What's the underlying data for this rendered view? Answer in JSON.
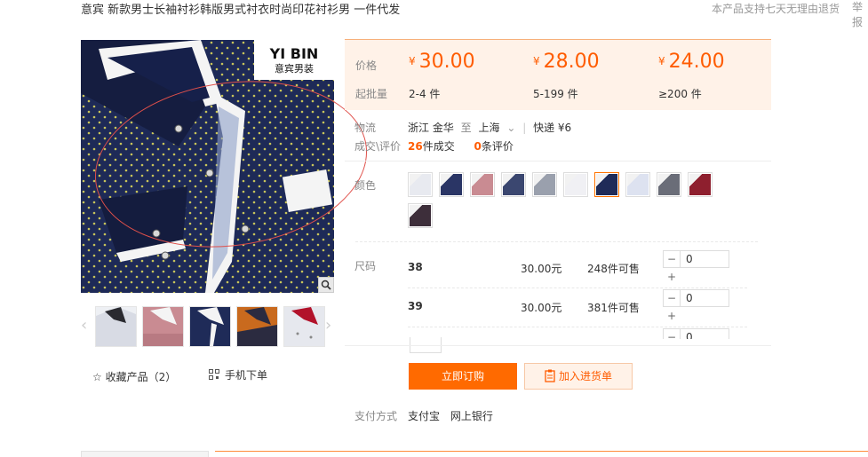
{
  "header": {
    "title": "意宾 新款男士长袖衬衫韩版男式衬衣时尚印花衬衫男 一件代发",
    "notice": "本产品支持七天无理由退货",
    "report": "举报"
  },
  "gallery": {
    "brand_en": "YI BIN",
    "brand_cn": "意宾男装",
    "prev": "‹",
    "next": "›",
    "thumbs": [
      "white-shirt",
      "pink-print-shirt",
      "navy-shirt",
      "orange-print-shirt",
      "white-print-shirt"
    ],
    "favorite": "☆ 收藏产品（2）",
    "mobile_order": "手机下单"
  },
  "pricing": {
    "price_label": "价格",
    "moq_label": "起批量",
    "currency": "¥",
    "tiers": [
      {
        "price": "30.00",
        "moq": "2-4 件"
      },
      {
        "price": "28.00",
        "moq": "5-199 件"
      },
      {
        "price": "24.00",
        "moq": "≥200 件"
      }
    ]
  },
  "logistics": {
    "label": "物流",
    "from": "浙江 金华",
    "to_word": "至",
    "to": "上海",
    "dropdown": "⌄",
    "divider": "|",
    "express": "快递 ¥6"
  },
  "stats": {
    "label": "成交\\评价",
    "sold_count": "26",
    "sold_text": "件成交",
    "review_count": "0",
    "review_text": "条评价"
  },
  "colors": {
    "label": "颜色",
    "accent": "#ff5c00",
    "swatches": [
      {
        "name": "white",
        "color": "#e8eaf0",
        "selected": false
      },
      {
        "name": "navy-white",
        "color": "#2a3565",
        "selected": false
      },
      {
        "name": "pink",
        "color": "#c98b92",
        "selected": false
      },
      {
        "name": "dark-blue",
        "color": "#3b4770",
        "selected": false
      },
      {
        "name": "grey",
        "color": "#9aa0ad",
        "selected": false
      },
      {
        "name": "light-white",
        "color": "#f0f0f4",
        "selected": false
      },
      {
        "name": "navy",
        "color": "#1f2b58",
        "selected": true
      },
      {
        "name": "white-blue",
        "color": "#dde2f0",
        "selected": false
      },
      {
        "name": "black-white",
        "color": "#6a6d78",
        "selected": false
      },
      {
        "name": "wine-red",
        "color": "#8e1f2e",
        "selected": false
      },
      {
        "name": "brown-navy",
        "color": "#3d2e3a",
        "selected": false
      }
    ]
  },
  "sizes": {
    "label": "尺码",
    "rows": [
      {
        "size": "38",
        "price": "30.00元",
        "stock": "248件可售",
        "qty": "0",
        "minus": "−",
        "plus": "+"
      },
      {
        "size": "39",
        "price": "30.00元",
        "stock": "381件可售",
        "qty": "0",
        "minus": "−",
        "plus": "+"
      }
    ],
    "partial_qty": "0",
    "partial_minus": "−"
  },
  "actions": {
    "order": "立即订购",
    "cart": "加入进货单"
  },
  "payment": {
    "label": "支付方式",
    "methods": [
      "支付宝",
      "网上银行"
    ]
  }
}
